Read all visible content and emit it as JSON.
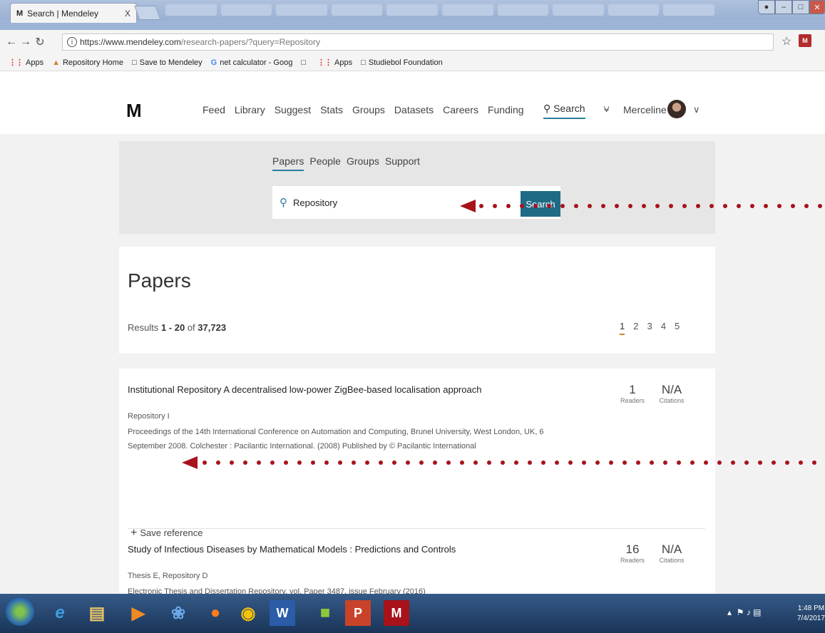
{
  "browser": {
    "tab_logo": "M",
    "tab_title": "Search | Mendeley",
    "tab_close": "X",
    "url_domain": "https://www.mendeley.com",
    "url_path": "/research-papers/?query=Repository",
    "extension": "M"
  },
  "bookmarks": [
    {
      "label": "Apps",
      "icon": "apps-grid-icon"
    },
    {
      "label": "Repository Home",
      "icon": "repository-icon"
    },
    {
      "label": "Save to Mendeley",
      "icon": "page-icon"
    },
    {
      "label": "net calculator - Goog",
      "icon": "google-icon"
    },
    {
      "label": "",
      "icon": "page-icon"
    },
    {
      "label": "Apps",
      "icon": "apps-grid-icon"
    },
    {
      "label": "Studiebol Foundation",
      "icon": "page-icon"
    }
  ],
  "nav": {
    "brand": "M",
    "links": [
      "Feed",
      "Library",
      "Suggest",
      "Stats",
      "Groups",
      "Datasets",
      "Careers",
      "Funding"
    ],
    "search": "Search",
    "user": "Merceline"
  },
  "search": {
    "tabs": [
      "Papers",
      "People",
      "Groups",
      "Support"
    ],
    "query": "Repository",
    "button": "Search"
  },
  "papers": {
    "heading": "Papers",
    "results_prefix": "Results ",
    "results_range": "1 - 20",
    "results_of": " of ",
    "results_total": "37,723",
    "pages": [
      "1",
      "2",
      "3",
      "4",
      "5"
    ]
  },
  "items": [
    {
      "title": "Institutional Repository A decentralised low-power ZigBee-based localisation approach",
      "authors": "Repository I",
      "publication": "Proceedings of the 14th International Conference on Automation and Computing, Brunel University, West London, UK, 6 September 2008. Colchester : Pacilantic International. (2008) Published by © Pacilantic International",
      "readers": "1",
      "citations": "N/A",
      "readers_label": "Readers",
      "citations_label": "Citations",
      "save": "Save reference"
    },
    {
      "title": "Study of Infectious Diseases by Mathematical Models : Predictions and Controls",
      "authors": "Thesis E, Repository D",
      "publication": "Electronic Thesis and Dissertation Repository, vol. Paper 3487, issue February (2016)",
      "readers": "16",
      "citations": "N/A",
      "readers_label": "Readers",
      "citations_label": "Citations"
    }
  ],
  "taskbar": {
    "time": "1:48 PM",
    "date": "7/4/2017"
  }
}
